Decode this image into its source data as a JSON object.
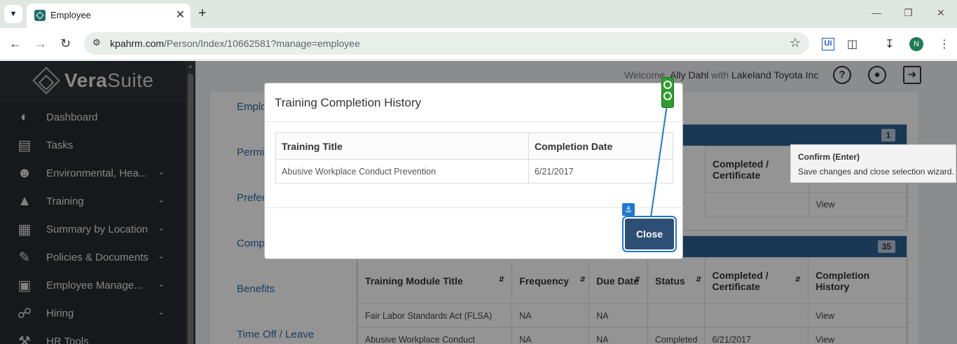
{
  "browser": {
    "tab_title": "Employee",
    "url_host": "kpahrm.com",
    "url_path": "/Person/Index/10662581?manage=employee",
    "avatar_letter": "N",
    "ext_ui_label": "Ui"
  },
  "sidebar": {
    "logo_bold": "Vera",
    "logo_light": "Suite",
    "items": [
      {
        "label": "Dashboard",
        "icon": "dashboard-icon",
        "chevron": false
      },
      {
        "label": "Tasks",
        "icon": "tasks-icon",
        "chevron": false
      },
      {
        "label": "Environmental, Hea...",
        "icon": "safety-icon",
        "chevron": true
      },
      {
        "label": "Training",
        "icon": "graduation-cap-icon",
        "chevron": true
      },
      {
        "label": "Summary by Location",
        "icon": "building-icon",
        "chevron": true
      },
      {
        "label": "Policies & Documents",
        "icon": "document-pen-icon",
        "chevron": true
      },
      {
        "label": "Employee Manage...",
        "icon": "id-card-icon",
        "chevron": true
      },
      {
        "label": "Hiring",
        "icon": "handshake-icon",
        "chevron": true
      },
      {
        "label": "HR Tools",
        "icon": "tools-icon",
        "chevron": false
      }
    ]
  },
  "header": {
    "welcome": "Welcome,",
    "user": "Ally Dahl",
    "with": "with",
    "company": "Lakeland Toyota Inc"
  },
  "left_nav": [
    "Emplo",
    "Permi",
    "Prefer",
    "Comp",
    "Benefits",
    "Time Off / Leave"
  ],
  "panel1": {
    "badge": "1",
    "headers": [
      "Completed / Certificate"
    ],
    "row": {
      "partial": "e",
      "history": "View"
    }
  },
  "panel2": {
    "badge": "35",
    "headers": [
      "Training Module Title",
      "Frequency",
      "Due Date",
      "Status",
      "Completed / Certificate",
      "Completion History"
    ],
    "rows": [
      [
        "Fair Labor Standards Act (FLSA)",
        "NA",
        "NA",
        "",
        "",
        "View"
      ],
      [
        "Abusive Workplace Conduct",
        "NA",
        "NA",
        "Completed",
        "6/21/2017",
        "View"
      ]
    ]
  },
  "modal": {
    "title": "Training Completion History",
    "headers": [
      "Training Title",
      "Completion Date"
    ],
    "rows": [
      [
        "Abusive Workplace Conduct Prevention",
        "6/21/2017"
      ]
    ],
    "close_label": "Close"
  },
  "tooltip": {
    "title": "Confirm (Enter)",
    "body": "Save changes and close selection wizard."
  }
}
